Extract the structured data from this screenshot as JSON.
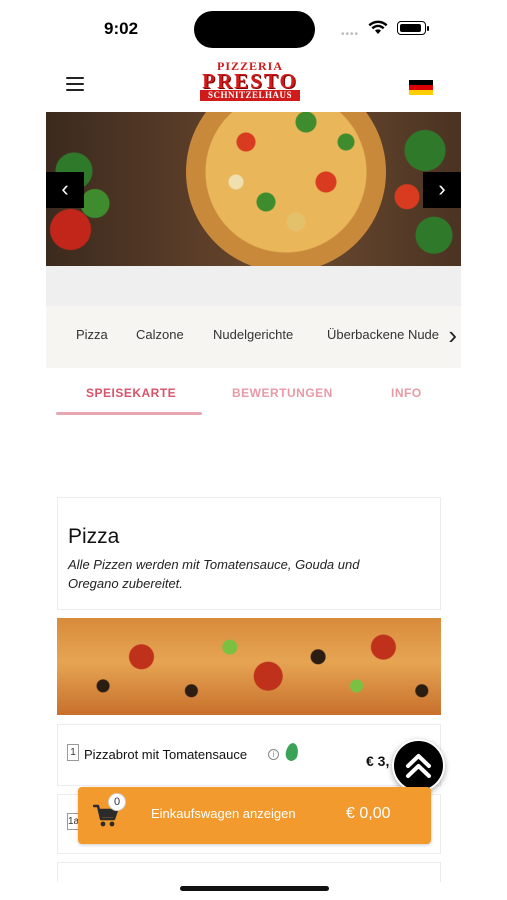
{
  "status_bar": {
    "time": "9:02"
  },
  "header": {
    "logo_line1": "PIZZERIA",
    "logo_line2": "PRESTO",
    "logo_line3": "SCHNITZELHAUS",
    "language_flag": "de-flag"
  },
  "categories": [
    {
      "label": "Pizza"
    },
    {
      "label": "Calzone"
    },
    {
      "label": "Nudelgerichte"
    },
    {
      "label": "Überbackene Nude"
    }
  ],
  "tabs": [
    {
      "label": "SPEISEKARTE",
      "active": true
    },
    {
      "label": "BEWERTUNGEN",
      "active": false
    },
    {
      "label": "INFO",
      "active": false
    }
  ],
  "section": {
    "title": "Pizza",
    "description": "Alle Pizzen werden mit Tomatensauce, Gouda und Oregano zubereitet."
  },
  "items": [
    {
      "number": "1",
      "name": "Pizzabrot mit Tomatensauce",
      "price": "€ 3,",
      "vegetarian": true
    },
    {
      "number": "1a"
    }
  ],
  "cart": {
    "count": "0",
    "label": "Einkaufswagen anzeigen",
    "total": "€ 0,00"
  },
  "colors": {
    "accent_orange": "#f39a2e",
    "tab_active": "#d9536a",
    "logo_red": "#d11a1a"
  }
}
